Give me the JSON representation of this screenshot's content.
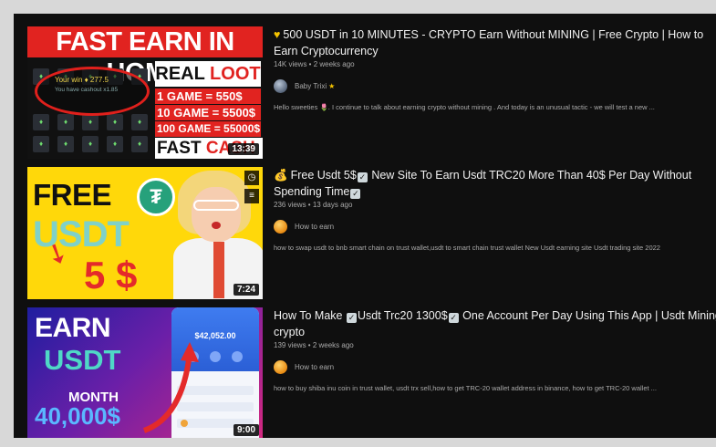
{
  "videos": [
    {
      "title_icon": "yellow-heart",
      "title": "500 USDT in 10 MINUTES - CRYPTO Earn Without MINING | Free Crypto | How to Earn Cryptocurrency",
      "meta": "14K views • 2 weeks ago",
      "channel": "Baby Trixi",
      "channel_badge": "★",
      "description": "Hello sweeties 🌷. I continue to talk about earning crypto without mining . And today is an unusual tactic - we will test a new ...",
      "duration": "13:39",
      "thumb": {
        "banner": "FAST EARN IN HOME",
        "win_text": "Your win ♦ 277.5",
        "cashout_text": "You have cashout x1.85",
        "loot_a": "REAL",
        "loot_b": "LOOT",
        "games": [
          "1 GAME = 550$",
          "10 GAME = 5500$",
          "100 GAME = 55000$"
        ],
        "fast_a": "FAST",
        "fast_b": "CASH"
      }
    },
    {
      "title_icon": "money-bag",
      "title_parts": [
        "Free Usdt 5$",
        "New Site To Earn Usdt TRC20 More Than 40$ Per Day Without Spending Time"
      ],
      "meta": "236 views • 13 days ago",
      "channel": "How to earn",
      "description": "how to swap usdt to bnb smart chain on trust wallet,usdt to smart chain trust wallet New Usdt earning site Usdt trading site 2022",
      "duration": "7:24",
      "thumb": {
        "free": "FREE",
        "tether_symbol": "₮",
        "usdt": "USDT",
        "five": "5 $"
      }
    },
    {
      "title_parts": [
        "How To Make",
        "Usdt Trc20 1300$",
        "One Account Per Day Using This App | Usdt Mining crypto"
      ],
      "meta": "139 views • 2 weeks ago",
      "channel": "How to earn",
      "description": "how to buy shiba inu coin in trust wallet, usdt trx sell,how to get TRC-20 wallet address in binance, how to get TRC-20 wallet ...",
      "duration": "9:00",
      "thumb": {
        "earn": "EARN",
        "usdt": "USDT",
        "month": "MONTH",
        "amount": "40,000$",
        "balance": "$42,052.00"
      }
    }
  ],
  "check_mark": "✓",
  "colors": {
    "accent_red": "#e12320",
    "usdt_green": "#26a17b",
    "bg": "#0f0f0f"
  }
}
